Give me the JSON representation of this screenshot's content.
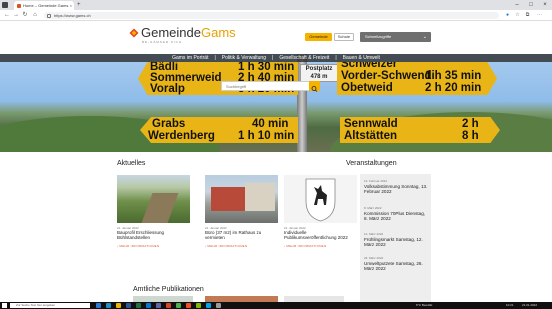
{
  "browser": {
    "tab_title": "Home – Gemeinde Gams",
    "tab_close": "×",
    "new_tab": "+",
    "url": "https://www.gams.ch",
    "minimize": "–",
    "maximize": "□",
    "close": "×"
  },
  "header": {
    "brand_part1": "Gemeinde",
    "brand_part2": "Gams",
    "tagline": "BE-GÄMSER SICH",
    "btn_gemeinde": "Gemeinde",
    "btn_schule": "Schule",
    "select_label": "Schnellzugriffe",
    "colors": {
      "accent": "#f5b300",
      "select": "#6f6f6f"
    }
  },
  "nav": {
    "items": [
      "Gams im Porträt",
      "Politik & Verwaltung",
      "Gesellschaft & Freizeit",
      "Bauen & Umwelt"
    ],
    "separator": "|"
  },
  "hero": {
    "sign_left_top": [
      "Bädli",
      "Sommerweid",
      "Voralp"
    ],
    "sign_left_top_times": [
      "1 h 30 min",
      "2 h 40 min",
      "3 h 20 min"
    ],
    "sign_post": [
      "Postplatz",
      "478 m"
    ],
    "sign_right_top": [
      "Schweizer",
      "Vorder-Schwendi",
      "Obetweid"
    ],
    "sign_right_top_times": [
      "1 h 35 min",
      "2 h 20 min"
    ],
    "sign_left_bottom": [
      "Grabs",
      "Werdenberg"
    ],
    "sign_left_bottom_times": [
      "40 min",
      "1 h 10 min"
    ],
    "sign_right_bottom": [
      "Sennwald",
      "Altstätten"
    ],
    "sign_right_bottom_times": [
      "2 h",
      "8 h"
    ],
    "search_placeholder": "Suchbegriff"
  },
  "aktuelles": {
    "heading": "Aktuelles",
    "items": [
      {
        "date": "21. Januar 2022",
        "title": "Bauprofil Erschliessung Bühlstandstellen",
        "more": "› MEHR INFORMATIONEN"
      },
      {
        "date": "21. Januar 2022",
        "title": "Büro (37 m2) im Rathaus zu vermieten",
        "more": "› MEHR INFORMATIONEN"
      },
      {
        "date": "21. Januar 2022",
        "title": "Individuelle Publikumsveröffentlichung 2022",
        "more": "› MEHR INFORMATIONEN"
      }
    ]
  },
  "veranstaltungen": {
    "heading": "Veranstaltungen",
    "items": [
      {
        "date": "13. Februar 2022",
        "title": "Volksabstimmung Sonntag, 13. Februar 2022"
      },
      {
        "date": "8. März 2022",
        "title": "Kommission 70Plus Dienstag, 8. März 2022"
      },
      {
        "date": "12. März 2022",
        "title": "Frühlingsmarkt Samstag, 12. März 2022"
      },
      {
        "date": "26. März 2022",
        "title": "Umweltputzete Samstag, 26. März 2022"
      }
    ]
  },
  "publikationen": {
    "heading": "Amtliche Publikationen"
  },
  "taskbar": {
    "search_placeholder": "Zur Suche Text hier eingeben",
    "weather": "6°C Bewölkt",
    "time": "10:21",
    "date": "21.01.2022"
  }
}
